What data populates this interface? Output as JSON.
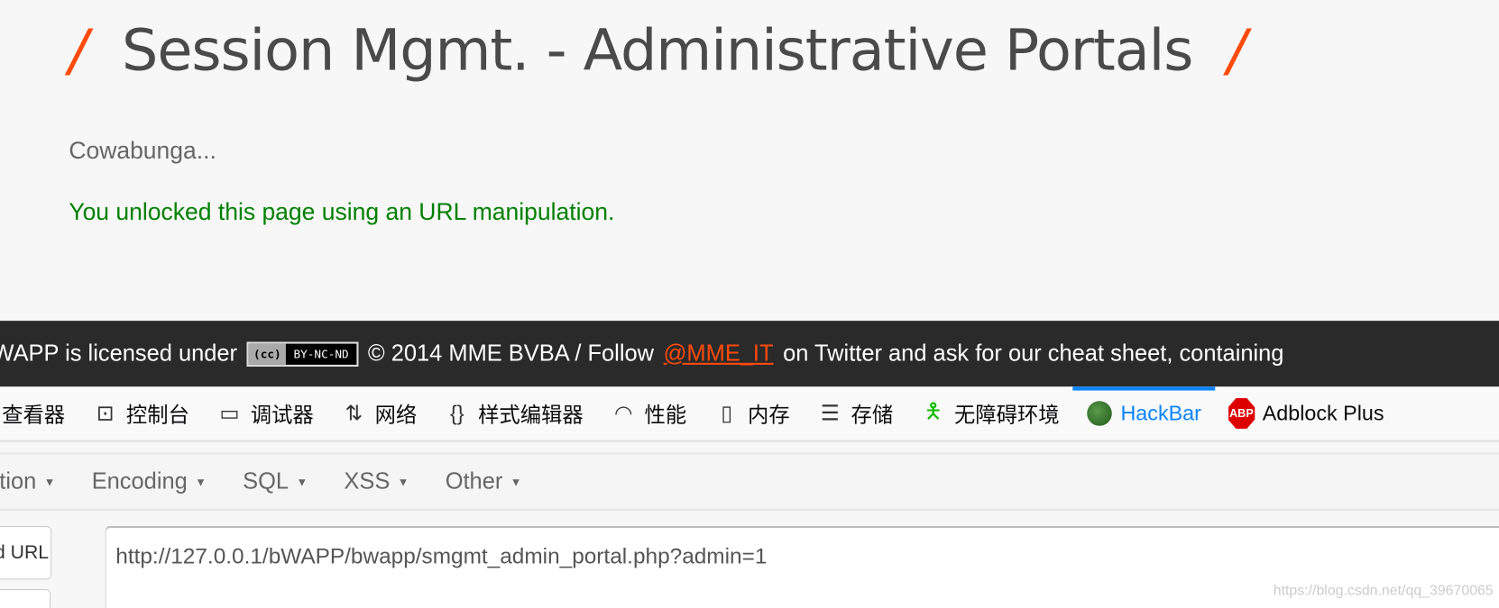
{
  "page": {
    "title": "Session Mgmt. - Administrative Portals",
    "title_slash": "/",
    "line1": "Cowabunga...",
    "line2": "You unlocked this page using an URL manipulation."
  },
  "footer": {
    "prefix": "WAPP is licensed under",
    "cc_icon": "(cc)",
    "cc_label": "BY-NC-ND",
    "middle": "© 2014 MME BVBA / Follow",
    "link": "@MME_IT",
    "suffix": "on Twitter and ask for our cheat sheet, containing"
  },
  "devtools": {
    "tabs": [
      {
        "label": "查看器",
        "icon": "inspector-icon"
      },
      {
        "label": "控制台",
        "icon": "console-icon"
      },
      {
        "label": "调试器",
        "icon": "debugger-icon"
      },
      {
        "label": "网络",
        "icon": "network-icon"
      },
      {
        "label": "样式编辑器",
        "icon": "style-editor-icon"
      },
      {
        "label": "性能",
        "icon": "performance-icon"
      },
      {
        "label": "内存",
        "icon": "memory-icon"
      },
      {
        "label": "存储",
        "icon": "storage-icon"
      },
      {
        "label": "无障碍环境",
        "icon": "accessibility-icon"
      },
      {
        "label": "HackBar",
        "icon": "hackbar-icon",
        "active": true
      },
      {
        "label": "Adblock Plus",
        "icon": "abp-icon"
      }
    ],
    "abp_badge": "ABP",
    "active_color": "#0a84ff"
  },
  "hackbar": {
    "menus": [
      "ption",
      "Encoding",
      "SQL",
      "XSS",
      "Other"
    ],
    "load_url": "ad URL",
    "url": "http://127.0.0.1/bWAPP/bwapp/smgmt_admin_portal.php?admin=1"
  },
  "watermark": "https://blog.csdn.net/qq_39670065"
}
